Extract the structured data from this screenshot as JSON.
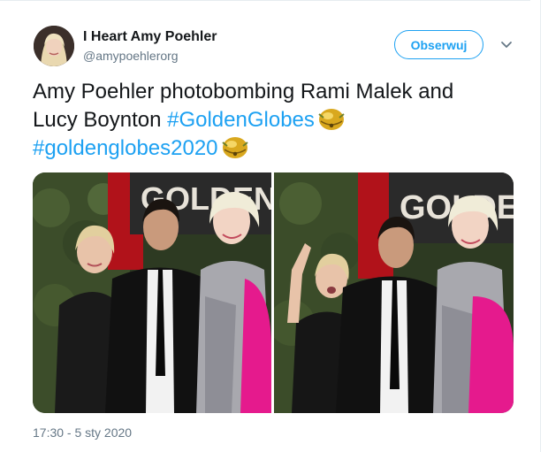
{
  "author": {
    "display_name": "I Heart Amy Poehler",
    "handle": "@amypoehlerorg"
  },
  "follow_button": {
    "label": "Obserwuj"
  },
  "more_menu": {
    "icon": "chevron-down-icon"
  },
  "tweet": {
    "line1": "Amy Poehler photobombing Rami Malek and",
    "line2_text": "Lucy Boynton ",
    "hashtag1": "#GoldenGlobes",
    "hashtag2": "#goldenglobes2020",
    "emoji": "golden-globe-bell-emoji"
  },
  "media": {
    "photo_left": {
      "sign_text": "GOLDEN"
    },
    "photo_right": {
      "sign_text": "GOLDE"
    }
  },
  "timestamp": "17:30 - 5 sty 2020",
  "colors": {
    "accent": "#1da1f2",
    "text": "#14171a",
    "secondary": "#657786",
    "border": "#e6ecf0"
  }
}
